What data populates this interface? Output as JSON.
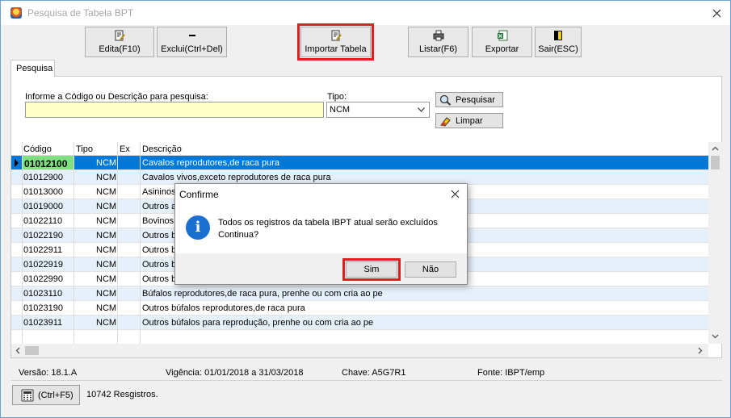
{
  "window": {
    "title": "Pesquisa de Tabela BPT"
  },
  "toolbar": {
    "edit_label": "Edita(F10)",
    "delete_label": "Exclui(Ctrl+Del)",
    "import_label": "Importar Tabela",
    "list_label": "Listar(F6)",
    "export_label": "Exportar",
    "exit_label": "Sair(ESC)"
  },
  "tabs": {
    "search": "Pesquisa"
  },
  "search": {
    "label": "Informe a Código ou Descrição para pesquisa:",
    "value": "",
    "type_label": "Tipo:",
    "type_value": "NCM",
    "search_button": "Pesquisar",
    "clear_button": "Limpar"
  },
  "grid": {
    "columns": {
      "code": "Código",
      "type": "Tipo",
      "ex": "Ex",
      "description": "Descrição"
    },
    "rows": [
      {
        "code": "01012100",
        "type": "NCM",
        "ex": "",
        "description": "Cavalos reprodutores,de raca pura"
      },
      {
        "code": "01012900",
        "type": "NCM",
        "ex": "",
        "description": "Cavalos vivos,exceto reprodutores de raca pura"
      },
      {
        "code": "01013000",
        "type": "NCM",
        "ex": "",
        "description": "Asininos"
      },
      {
        "code": "01019000",
        "type": "NCM",
        "ex": "",
        "description": "Outros a"
      },
      {
        "code": "01022110",
        "type": "NCM",
        "ex": "",
        "description": "Bovinos"
      },
      {
        "code": "01022190",
        "type": "NCM",
        "ex": "",
        "description": "Outros b"
      },
      {
        "code": "01022911",
        "type": "NCM",
        "ex": "",
        "description": "Outros b"
      },
      {
        "code": "01022919",
        "type": "NCM",
        "ex": "",
        "description": "Outros b"
      },
      {
        "code": "01022990",
        "type": "NCM",
        "ex": "",
        "description": "Outros b"
      },
      {
        "code": "01023110",
        "type": "NCM",
        "ex": "",
        "description": "Búfalos reprodutores,de raca pura, prenhe ou com cria ao pe"
      },
      {
        "code": "01023190",
        "type": "NCM",
        "ex": "",
        "description": "Outros búfalos reprodutores,de raca pura"
      },
      {
        "code": "01023911",
        "type": "NCM",
        "ex": "",
        "description": "Outros búfalos para reprodução, prenhe ou com cria ao pe"
      }
    ]
  },
  "status": {
    "version": "Versão: 18.1.A",
    "validity": "Vigência: 01/01/2018 a 31/03/2018",
    "key": "Chave: A5G7R1",
    "source": "Fonte: IBPT/emp",
    "calc_label": "(Ctrl+F5)",
    "records": "10742 Resgistros."
  },
  "dialog": {
    "title": "Confirme",
    "line1": "Todos os registros da tabela IBPT atual serão excluídos",
    "line2": "Continua?",
    "yes": "Sim",
    "no": "Não"
  },
  "colors": {
    "selection": "#0078d7",
    "highlight": "#e02020",
    "code_highlight": "#7fe07f",
    "input_bg": "#ffffc8",
    "alt_row": "#e6f0fb"
  },
  "icons": [
    "app-icon",
    "close-icon",
    "edit-icon",
    "delete-icon",
    "import-icon",
    "print-icon",
    "excel-icon",
    "exit-icon",
    "magnifier-icon",
    "eraser-icon",
    "calculator-icon",
    "info-icon",
    "chevron-down-icon"
  ]
}
